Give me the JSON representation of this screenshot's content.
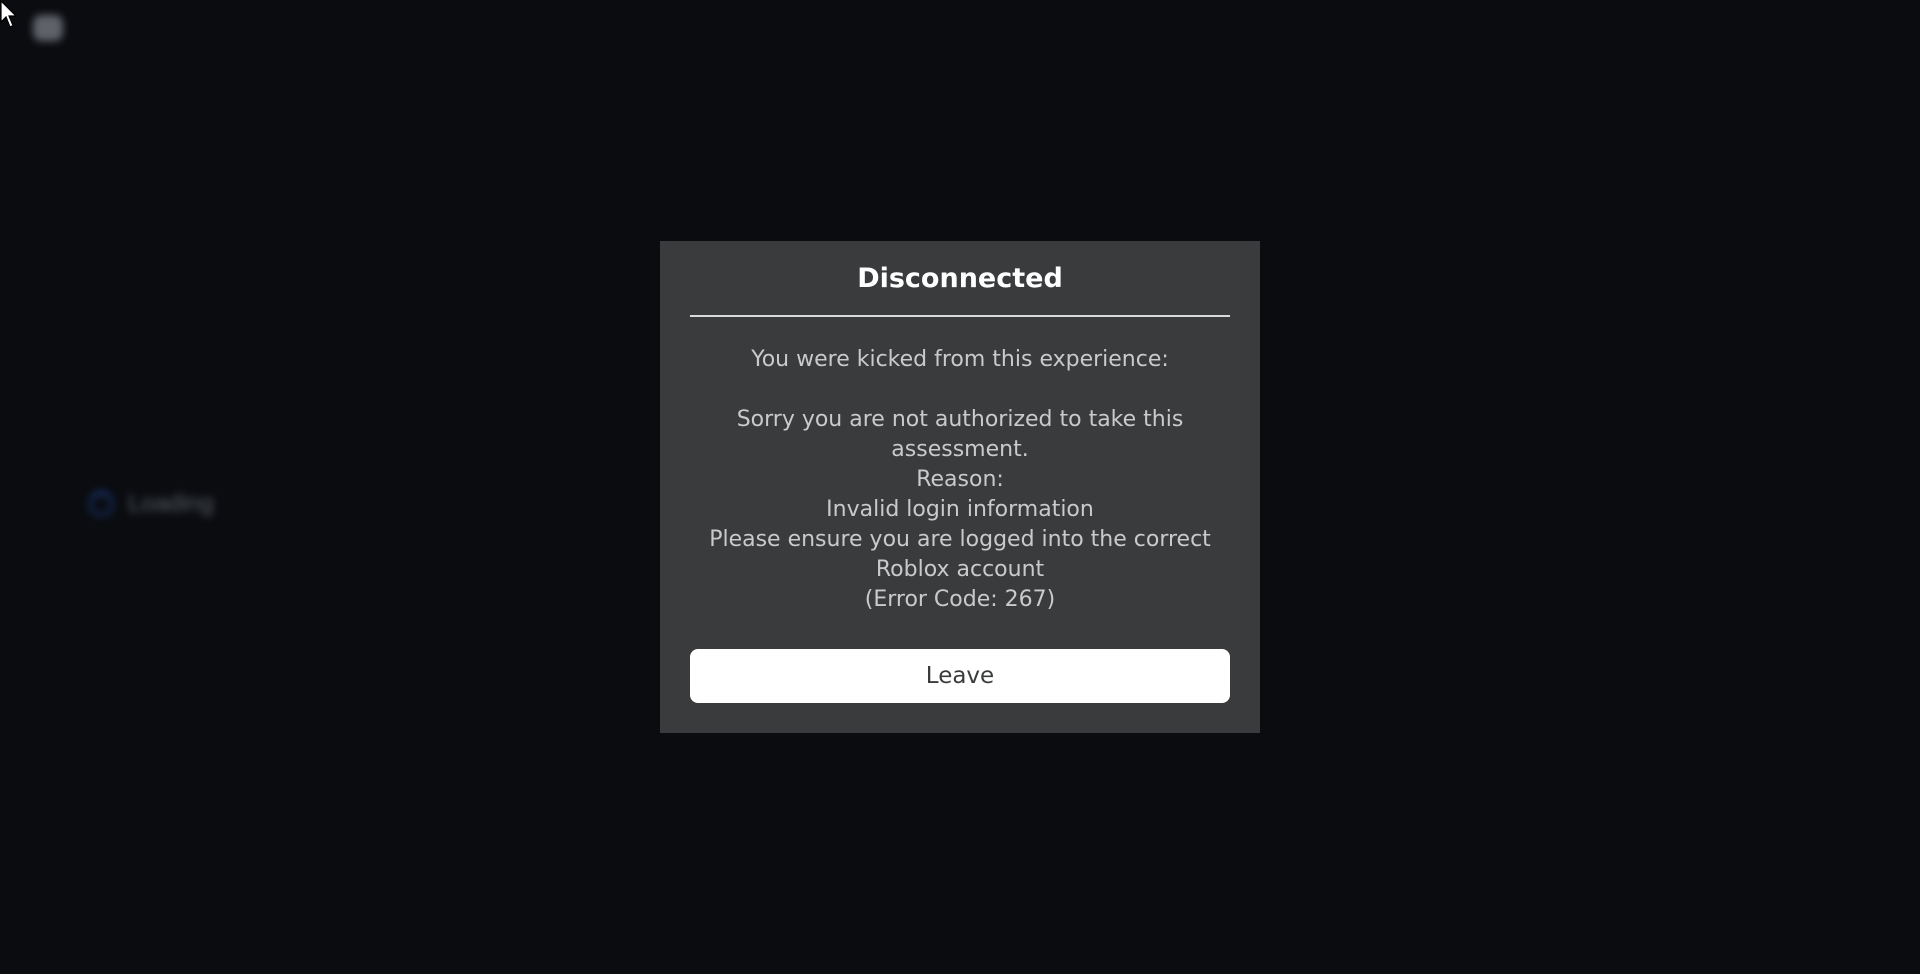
{
  "background": {
    "loading_label": "Loading",
    "menu_icon": "roblox-menu-icon",
    "cursor_icon": "mouse-pointer-icon"
  },
  "dialog": {
    "title": "Disconnected",
    "message_lines": [
      "You were kicked from this experience:",
      "",
      "Sorry you are not authorized to take this",
      "assessment.",
      "Reason:",
      "Invalid login information",
      "Please ensure you are logged into the correct",
      "Roblox account",
      "(Error Code: 267)"
    ],
    "leave_label": "Leave"
  },
  "colors": {
    "page_background": "#0a0c10",
    "dialog_background": "#393b3d",
    "title_text": "#ffffff",
    "body_text": "#c9cacc",
    "button_background": "#ffffff",
    "button_text": "#393b3d"
  }
}
